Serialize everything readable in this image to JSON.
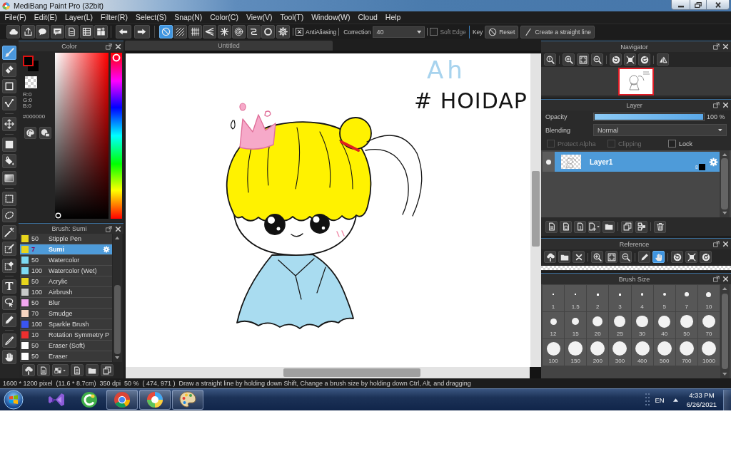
{
  "window": {
    "title": "MediBang Paint Pro (32bit)"
  },
  "menu": [
    "File(F)",
    "Edit(E)",
    "Layer(L)",
    "Filter(R)",
    "Select(S)",
    "Snap(N)",
    "Color(C)",
    "View(V)",
    "Tool(T)",
    "Window(W)",
    "Cloud",
    "Help"
  ],
  "toolbar": {
    "file_actions": [
      {
        "kind": "cloud"
      },
      {
        "kind": "upload"
      },
      {
        "kind": "speech-bubble"
      },
      {
        "kind": "message"
      },
      {
        "kind": "document"
      },
      {
        "kind": "list"
      },
      {
        "kind": "tiles"
      }
    ],
    "history": [
      {
        "kind": "undo"
      },
      {
        "kind": "redo"
      }
    ],
    "snap_modes": [
      {
        "kind": "no-entry",
        "selected": true
      },
      {
        "kind": "hatch",
        "selected": false
      },
      {
        "kind": "lines",
        "selected": false
      },
      {
        "kind": "perspective",
        "selected": false
      },
      {
        "kind": "asterisk",
        "selected": false
      },
      {
        "kind": "target",
        "selected": false
      },
      {
        "kind": "curve",
        "selected": false
      },
      {
        "kind": "ring",
        "selected": false
      },
      {
        "kind": "gear",
        "selected": false
      }
    ],
    "antialiasing": {
      "label": "AntiAliasing",
      "checked": true
    },
    "correction": {
      "label": "Correction",
      "value": "40"
    },
    "soft_edge": {
      "label": "Soft Edge",
      "checked": false
    },
    "key_label": "Key",
    "buttons": [
      {
        "kind": "no-entry",
        "label": "Reset"
      },
      {
        "kind": "slash",
        "label": "Create a straight line"
      }
    ]
  },
  "tools": [
    [
      {
        "kind": "brush",
        "selected": true
      },
      {
        "kind": "eraser",
        "selected": false
      },
      {
        "kind": "square",
        "selected": false
      },
      {
        "kind": "polyline",
        "selected": false
      }
    ],
    [
      {
        "kind": "move",
        "selected": false
      }
    ],
    [
      {
        "kind": "filled-square",
        "selected": false
      },
      {
        "kind": "bucket",
        "selected": false
      },
      {
        "kind": "gradient",
        "selected": false
      }
    ],
    [
      {
        "kind": "dashed-square",
        "selected": false
      },
      {
        "kind": "dashed-ellipse",
        "selected": false
      },
      {
        "kind": "wand",
        "selected": false
      },
      {
        "kind": "select-pen",
        "selected": false
      },
      {
        "kind": "select-eraser",
        "selected": false
      }
    ],
    [
      {
        "kind": "text",
        "glyph": "T",
        "selected": false
      },
      {
        "kind": "lasso-arrow",
        "selected": false
      },
      {
        "kind": "pen",
        "selected": false
      }
    ],
    [
      {
        "kind": "eyedropper",
        "selected": false
      },
      {
        "kind": "hand",
        "selected": false
      }
    ]
  ],
  "color_panel": {
    "title": "Color",
    "hue_slider": {
      "level": 0
    },
    "channels": [
      "R:0",
      "G:0",
      "B:0"
    ],
    "hex": "#000000",
    "actions": [
      {
        "kind": "palette"
      },
      {
        "kind": "palette-grid"
      }
    ]
  },
  "brush_panel": {
    "title": "Brush: Sumi",
    "brushes": [
      {
        "size": "50",
        "name": "Stipple Pen",
        "color": "#e8d51c",
        "selected": false
      },
      {
        "size": "7",
        "name": "Sumi",
        "color": "#e8d51c",
        "selected": true
      },
      {
        "size": "50",
        "name": "Watercolor",
        "color": "#7dd9f2",
        "selected": false
      },
      {
        "size": "100",
        "name": "Watercolor (Wet)",
        "color": "#7dd9f2",
        "selected": false
      },
      {
        "size": "50",
        "name": "Acrylic",
        "color": "#e8d51c",
        "selected": false
      },
      {
        "size": "100",
        "name": "Airbrush",
        "color": "#c9c9c9",
        "selected": false
      },
      {
        "size": "50",
        "name": "Blur",
        "color": "#f2a6f0",
        "selected": false
      },
      {
        "size": "70",
        "name": "Smudge",
        "color": "#f7d6c2",
        "selected": false
      },
      {
        "size": "100",
        "name": "Sparkle Brush",
        "color": "#3a55f0",
        "selected": false
      },
      {
        "size": "10",
        "name": "Rotation Symmetry P",
        "color": "#ec2f2f",
        "selected": false
      },
      {
        "size": "50",
        "name": "Eraser (Soft)",
        "color": "#ffffff",
        "selected": false
      },
      {
        "size": "50",
        "name": "Eraser",
        "color": "#ffffff",
        "selected": false
      }
    ],
    "actions": [
      {
        "kind": "cloud-arrow"
      },
      {
        "kind": "document"
      },
      {
        "kind": "tiles-caret"
      },
      {
        "kind": "document-lines"
      },
      {
        "kind": "folder"
      },
      {
        "kind": "copy"
      }
    ]
  },
  "canvas": {
    "tab": "Untitled",
    "handwriting": [
      {
        "text": "Ah",
        "color": "#a7d3ee"
      },
      {
        "text": "# HOIDAP",
        "color": "#141414"
      }
    ]
  },
  "navigator": {
    "title": "Navigator",
    "tools": [
      [
        {
          "kind": "zoom-actual"
        }
      ],
      [
        {
          "kind": "zoom-in"
        },
        {
          "kind": "fit"
        },
        {
          "kind": "zoom-out"
        }
      ],
      [
        {
          "kind": "rotate-left"
        },
        {
          "kind": "frame"
        },
        {
          "kind": "rotate-right"
        }
      ],
      [
        {
          "kind": "flip"
        }
      ]
    ]
  },
  "layer_panel": {
    "title": "Layer",
    "opacity": {
      "label": "Opacity",
      "level": 1,
      "reading": "100 %"
    },
    "blending": {
      "label": "Blending",
      "value": "Normal"
    },
    "options": [
      {
        "label": "Protect Alpha",
        "checked": false,
        "disabled": true
      },
      {
        "label": "Clipping",
        "checked": false,
        "disabled": true
      },
      {
        "label": "Lock",
        "checked": false,
        "disabled": false
      }
    ],
    "layers": [
      {
        "name": "Layer1",
        "bit_depth": "8",
        "visible": true,
        "selected": true
      }
    ],
    "actions": [
      [
        {
          "kind": "document"
        },
        {
          "kind": "document-8"
        },
        {
          "kind": "document-1"
        },
        {
          "kind": "document-plus-caret"
        },
        {
          "kind": "folder"
        }
      ],
      [
        {
          "kind": "copy"
        },
        {
          "kind": "merge"
        }
      ],
      [
        {
          "kind": "trash"
        }
      ]
    ]
  },
  "reference": {
    "title": "Reference",
    "tools": [
      [
        {
          "kind": "cloud-arrow",
          "selected": false
        },
        {
          "kind": "folder",
          "selected": false
        },
        {
          "kind": "close-x",
          "selected": false
        }
      ],
      [
        {
          "kind": "zoom-in",
          "selected": false
        },
        {
          "kind": "fit",
          "selected": false
        },
        {
          "kind": "zoom-out",
          "selected": false
        }
      ],
      [
        {
          "kind": "pen",
          "selected": false
        },
        {
          "kind": "hand",
          "selected": true
        }
      ],
      [
        {
          "kind": "rotate-left",
          "selected": false
        },
        {
          "kind": "frame",
          "selected": false
        },
        {
          "kind": "rotate-right",
          "selected": false
        }
      ]
    ]
  },
  "brush_size": {
    "title": "Brush Size",
    "sizes": [
      "1",
      "1.5",
      "2",
      "3",
      "4",
      "5",
      "7",
      "10",
      "12",
      "15",
      "20",
      "25",
      "30",
      "40",
      "50",
      "70",
      "100",
      "150",
      "200",
      "300",
      "400",
      "500",
      "700",
      "1000"
    ]
  },
  "status_bar": {
    "canvas_size": "1600 * 1200 pixel",
    "print_size": "(11.6 * 8.7cm)",
    "resolution": "350 dpi",
    "zoom": "50 %",
    "cursor": "( 474, 971 )",
    "hint": "Draw a straight line by holding down Shift, Change a brush size by holding down Ctrl, Alt, and dragging"
  },
  "taskbar": {
    "apps": [
      {
        "kind": "ribbon",
        "running": false
      },
      {
        "kind": "swirl-circle",
        "running": false
      },
      {
        "kind": "tricolor-circle",
        "running": true
      },
      {
        "kind": "color-wheel",
        "running": true
      },
      {
        "kind": "palette",
        "running": true
      }
    ],
    "language": "EN",
    "time": "4:33 PM",
    "date": "6/26/2021"
  }
}
